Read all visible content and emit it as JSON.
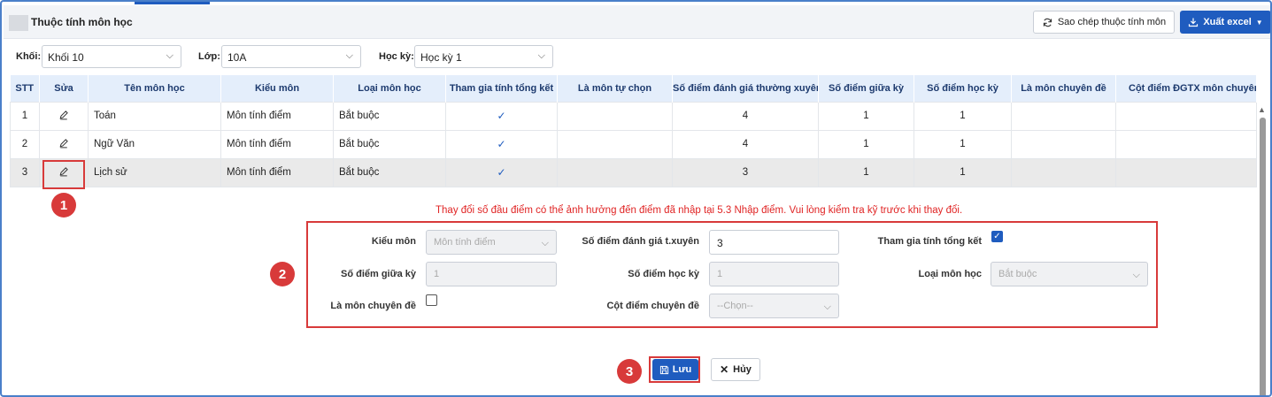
{
  "header": {
    "title": "Thuộc tính môn học",
    "copy_button": "Sao chép thuộc tính môn",
    "export_button": "Xuất excel"
  },
  "filters": {
    "khoi_label": "Khối:",
    "khoi_value": "Khối 10",
    "lop_label": "Lớp:",
    "lop_value": "10A",
    "hocky_label": "Học kỳ:",
    "hocky_value": "Học kỳ 1"
  },
  "table": {
    "columns": [
      "STT",
      "Sửa",
      "Tên môn học",
      "Kiểu môn",
      "Loại môn học",
      "Tham gia tính tổng kết",
      "Là môn tự chọn",
      "Số điểm đánh giá thường xuyên",
      "Số điểm giữa kỳ",
      "Số điểm học kỳ",
      "Là môn chuyên đề",
      "Cột điểm ĐGTX môn chuyên đề"
    ],
    "rows": [
      {
        "stt": "1",
        "ten": "Toán",
        "kieu": "Môn tính điểm",
        "loai": "Bắt buộc",
        "tong_ket": true,
        "tx": "4",
        "gk": "1",
        "hk": "1"
      },
      {
        "stt": "2",
        "ten": "Ngữ Văn",
        "kieu": "Môn tính điểm",
        "loai": "Bắt buộc",
        "tong_ket": true,
        "tx": "4",
        "gk": "1",
        "hk": "1"
      },
      {
        "stt": "3",
        "ten": "Lịch sử",
        "kieu": "Môn tính điểm",
        "loai": "Bắt buộc",
        "tong_ket": true,
        "tx": "3",
        "gk": "1",
        "hk": "1"
      }
    ]
  },
  "annotations": {
    "step1": "1",
    "step2": "2",
    "step3": "3"
  },
  "warning": "Thay đổi số đầu điểm có thể ảnh hưởng đến điểm đã nhập tại 5.3 Nhập điểm. Vui lòng kiểm tra kỹ trước khi thay đổi.",
  "form": {
    "kieu_mon_label": "Kiểu môn",
    "kieu_mon_value": "Môn tính điểm",
    "tx_label": "Số điểm đánh giá t.xuyên",
    "tx_value": "3",
    "tong_ket_label": "Tham gia tính tổng kết",
    "tong_ket_checked": true,
    "gk_label": "Số điểm giữa kỳ",
    "gk_value": "1",
    "hk_label": "Số điểm học kỳ",
    "hk_value": "1",
    "loai_label": "Loại môn học",
    "loai_value": "Bắt buộc",
    "chuyen_de_label": "Là môn chuyên đề",
    "chuyen_de_checked": false,
    "cot_diem_label": "Cột điểm chuyên đề",
    "cot_diem_placeholder": "--Chọn--"
  },
  "actions": {
    "save": "Lưu",
    "cancel": "Hủy"
  },
  "colors": {
    "primary": "#1f5cbf",
    "highlight": "#d83a3a",
    "warning_text": "#e02424",
    "header_bg": "#e4eefb"
  },
  "icons": [
    "refresh-icon",
    "download-icon",
    "pencil-icon",
    "check-icon",
    "save-icon",
    "close-icon",
    "chevron-down-icon"
  ]
}
